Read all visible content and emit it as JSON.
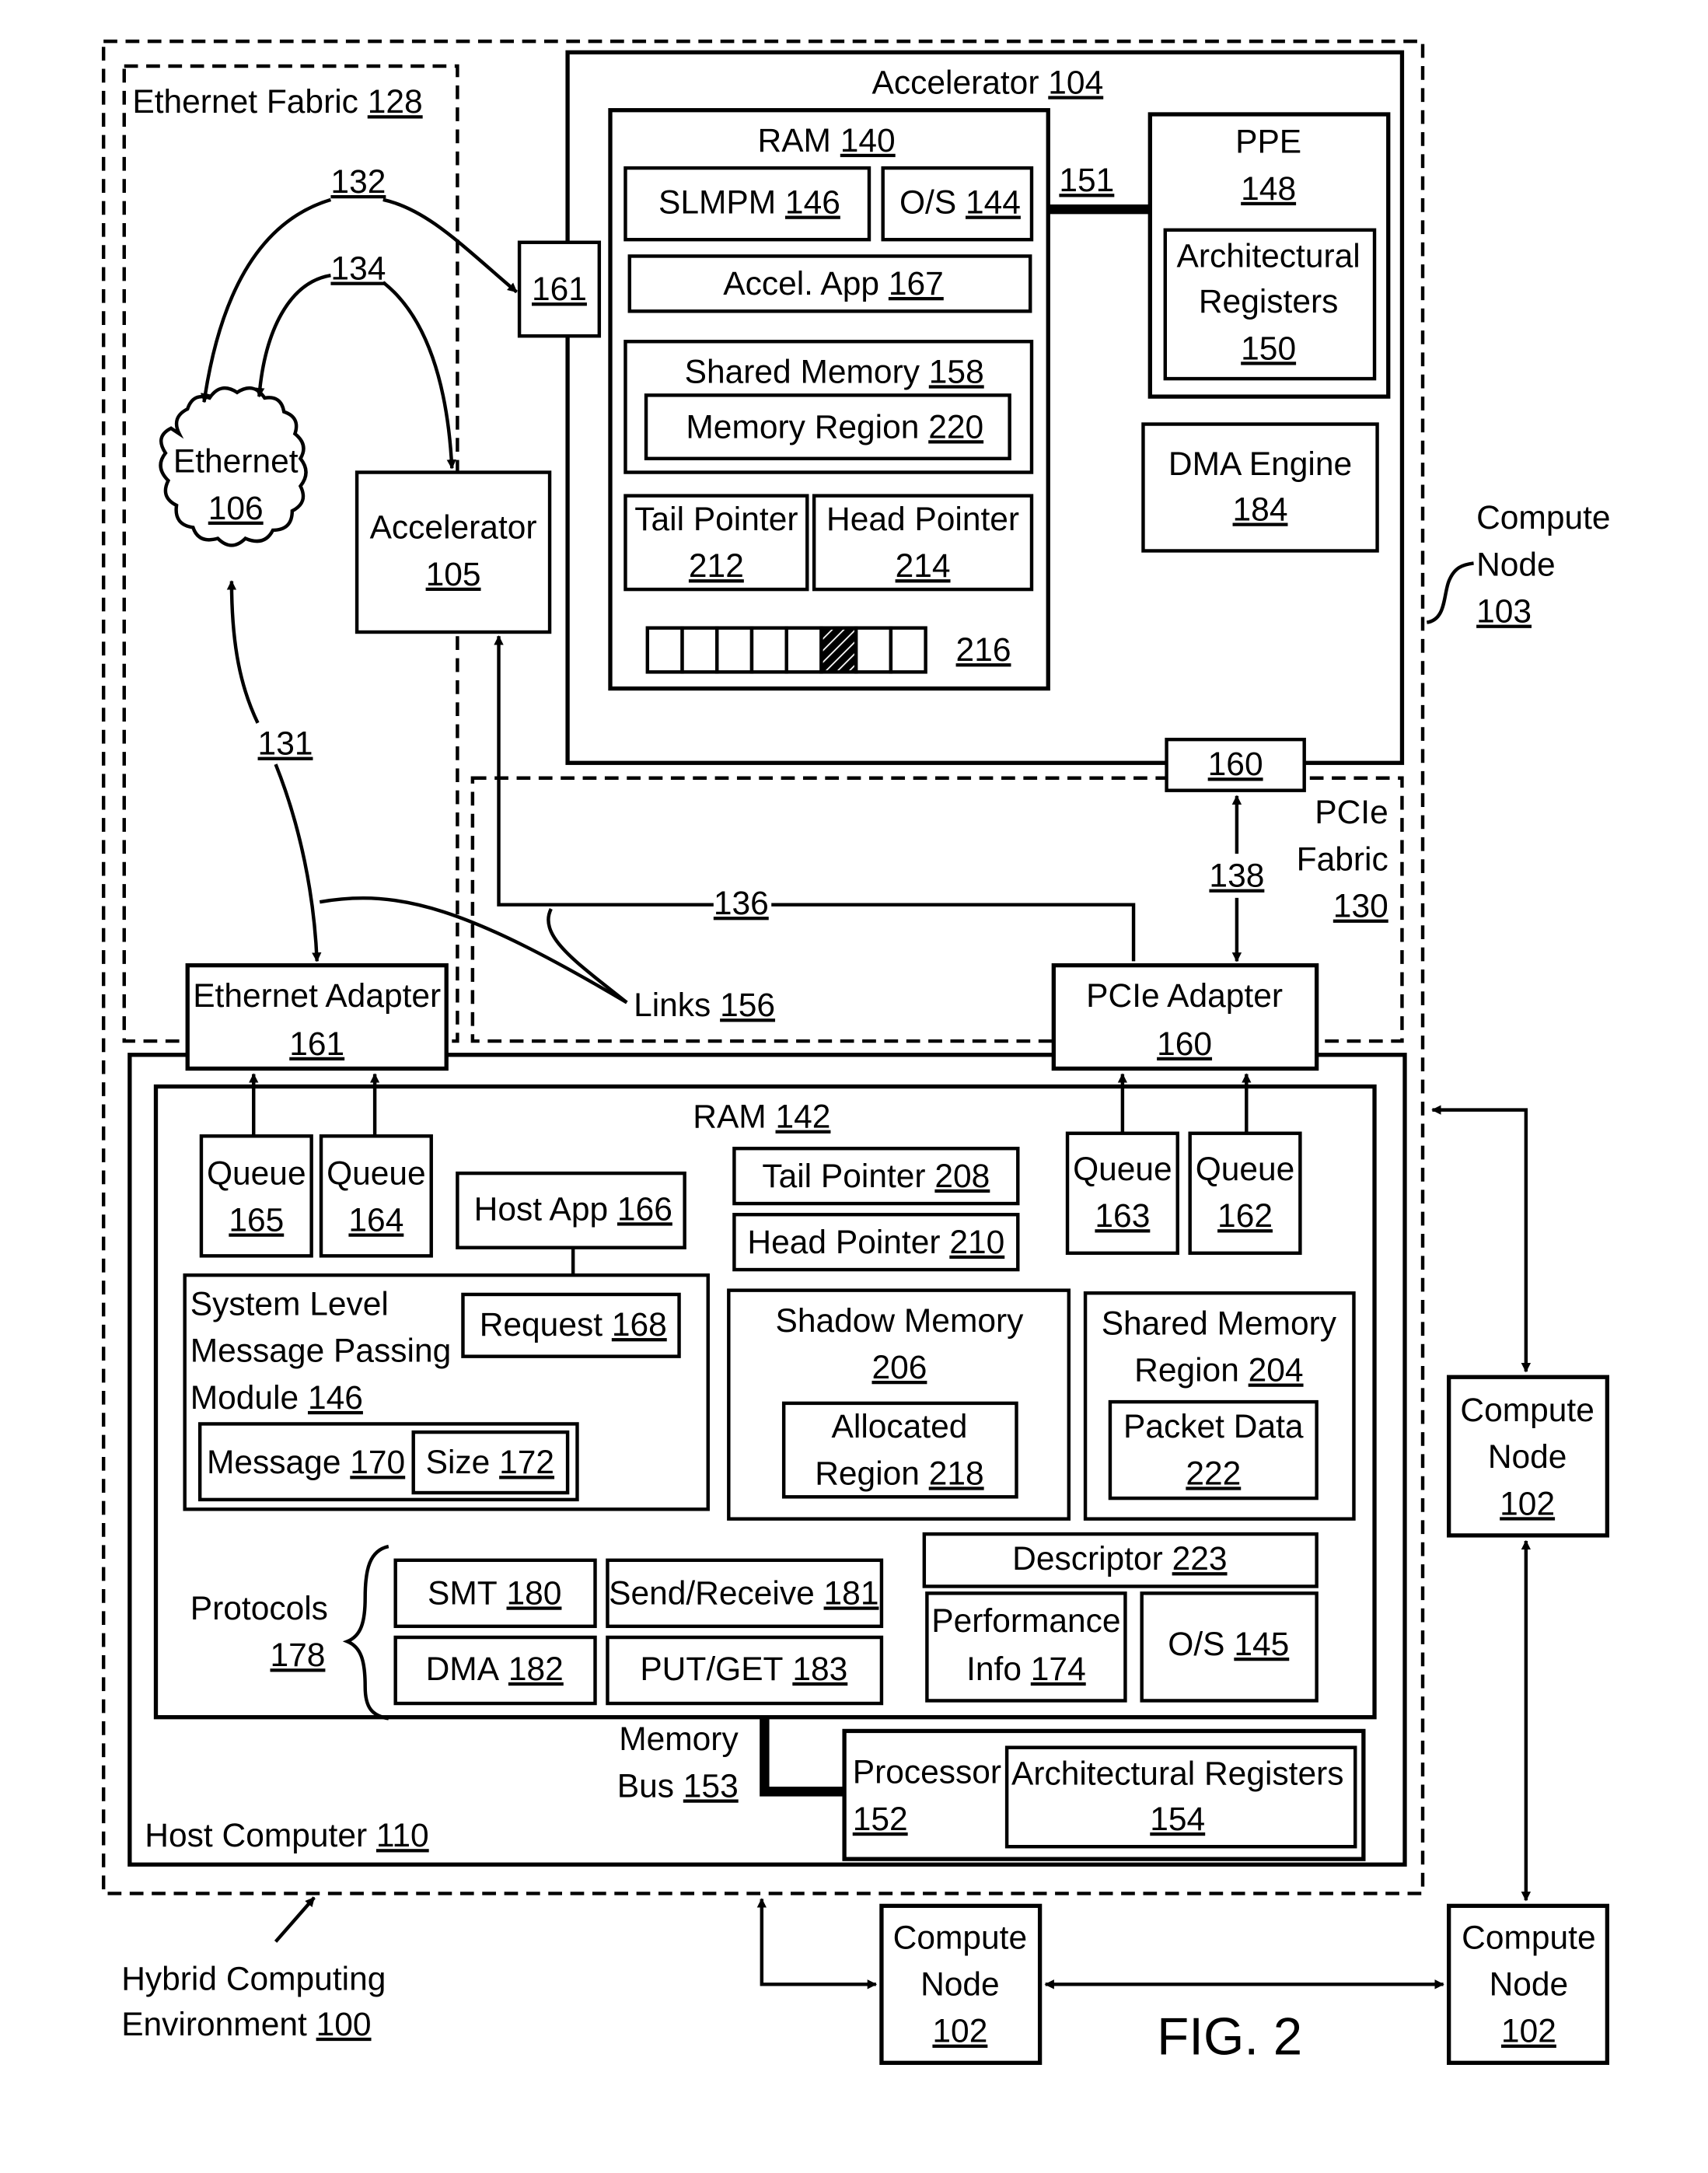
{
  "figure": {
    "title": "FIG. 2",
    "environment": {
      "label": "Hybrid Computing Environment",
      "ref": "100"
    }
  },
  "ethernet_fabric": {
    "label": "Ethernet Fabric",
    "ref": "128"
  },
  "pcie_fabric": {
    "line1": "PCIe",
    "line2": "Fabric",
    "ref": "130"
  },
  "compute_node_103": {
    "line1": "Compute",
    "line2": "Node",
    "ref": "103"
  },
  "ethernet": {
    "label": "Ethernet",
    "ref": "106"
  },
  "accelerator_105": {
    "label": "Accelerator",
    "ref": "105"
  },
  "port_161_accel": {
    "ref": "161"
  },
  "port_160_accel": {
    "ref": "160"
  },
  "links": {
    "l131": "131",
    "l132": "132",
    "l134": "134",
    "l136": "136",
    "l138": "138",
    "l151": "151",
    "links156": {
      "label": "Links",
      "ref": "156"
    },
    "memory_bus": {
      "line1": "Memory",
      "line2": "Bus",
      "ref": "153"
    }
  },
  "accelerator_104": {
    "label": "Accelerator",
    "ref": "104",
    "ram": {
      "label": "RAM",
      "ref": "140"
    },
    "slmpm": {
      "label": "SLMPM",
      "ref": "146"
    },
    "os": {
      "label": "O/S",
      "ref": "144"
    },
    "accel_app": {
      "label": "Accel. App",
      "ref": "167"
    },
    "shared_memory": {
      "label": "Shared Memory",
      "ref": "158"
    },
    "memory_region": {
      "label": "Memory Region",
      "ref": "220"
    },
    "tail_pointer": {
      "label": "Tail Pointer",
      "ref": "212"
    },
    "head_pointer": {
      "label": "Head Pointer",
      "ref": "214"
    },
    "buffer": {
      "ref": "216",
      "cells": 8,
      "hatched_index": 5
    },
    "ppe": {
      "label": "PPE",
      "ref": "148"
    },
    "arch_regs": {
      "line1": "Architectural",
      "line2": "Registers",
      "ref": "150"
    },
    "dma_engine": {
      "label": "DMA Engine",
      "ref": "184"
    }
  },
  "host": {
    "label": "Host Computer",
    "ref": "110",
    "ethernet_adapter": {
      "label": "Ethernet Adapter",
      "ref": "161"
    },
    "pcie_adapter": {
      "label": "PCIe Adapter",
      "ref": "160"
    },
    "ram": {
      "label": "RAM",
      "ref": "142"
    },
    "queues": [
      {
        "label": "Queue",
        "ref": "165"
      },
      {
        "label": "Queue",
        "ref": "164"
      },
      {
        "label": "Queue",
        "ref": "163"
      },
      {
        "label": "Queue",
        "ref": "162"
      }
    ],
    "host_app": {
      "label": "Host App",
      "ref": "166"
    },
    "tail_pointer": {
      "label": "Tail Pointer",
      "ref": "208"
    },
    "head_pointer": {
      "label": "Head Pointer",
      "ref": "210"
    },
    "slmpm": {
      "line1": "System Level",
      "line2": "Message Passing",
      "line3": "Module",
      "ref": "146"
    },
    "request": {
      "label": "Request",
      "ref": "168"
    },
    "message": {
      "label": "Message",
      "ref": "170"
    },
    "size": {
      "label": "Size",
      "ref": "172"
    },
    "shadow_memory": {
      "label": "Shadow Memory",
      "ref": "206"
    },
    "allocated_region": {
      "line1": "Allocated",
      "line2": "Region",
      "ref": "218"
    },
    "shared_memory_region": {
      "line1": "Shared Memory",
      "line2": "Region",
      "ref": "204"
    },
    "packet_data": {
      "label": "Packet Data",
      "ref": "222"
    },
    "protocols": {
      "label": "Protocols",
      "ref": "178"
    },
    "smt": {
      "label": "SMT",
      "ref": "180"
    },
    "send_receive": {
      "label": "Send/Receive",
      "ref": "181"
    },
    "dma": {
      "label": "DMA",
      "ref": "182"
    },
    "put_get": {
      "label": "PUT/GET",
      "ref": "183"
    },
    "descriptor": {
      "label": "Descriptor",
      "ref": "223"
    },
    "perf_info": {
      "line1": "Performance",
      "line2": "Info",
      "ref": "174"
    },
    "os": {
      "label": "O/S",
      "ref": "145"
    },
    "processor": {
      "label": "Processor",
      "ref": "152"
    },
    "arch_regs": {
      "label": "Architectural Registers",
      "ref": "154"
    }
  },
  "compute_nodes": [
    {
      "line1": "Compute",
      "line2": "Node",
      "ref": "102"
    },
    {
      "line1": "Compute",
      "line2": "Node",
      "ref": "102"
    },
    {
      "line1": "Compute",
      "line2": "Node",
      "ref": "102"
    }
  ]
}
